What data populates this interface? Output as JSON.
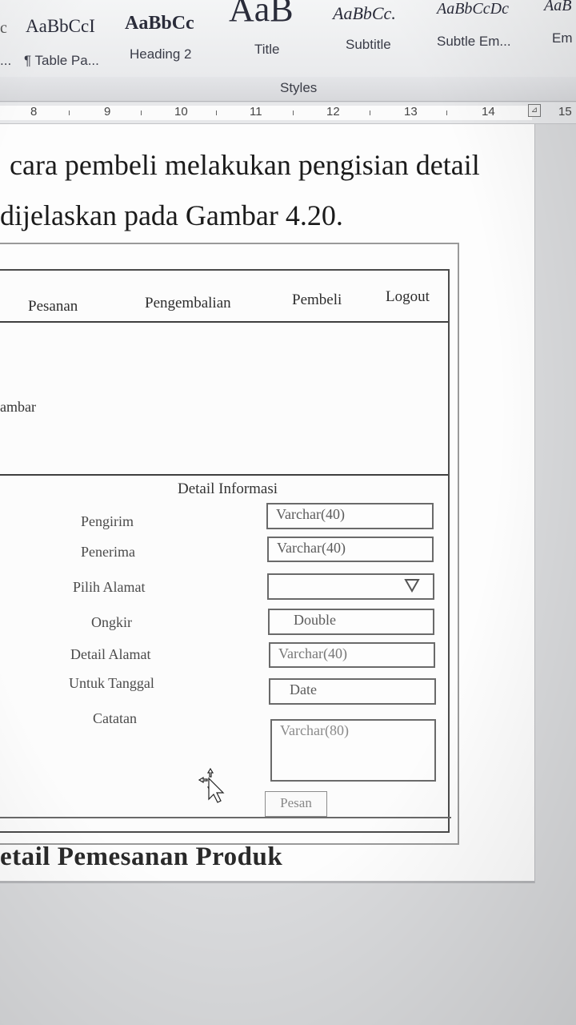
{
  "ribbon": {
    "styles": [
      {
        "sample": "AaBbCcI",
        "name": "¶ Table Pa..."
      },
      {
        "sample": "AaBbCc",
        "name": "Heading 2"
      },
      {
        "sample": "AaB",
        "name": "Title"
      },
      {
        "sample": "AaBbCc.",
        "name": "Subtitle"
      },
      {
        "sample": "AaBbCcDc",
        "name": "Subtle Em..."
      },
      {
        "sample": "AaB",
        "name": "Em"
      }
    ],
    "group_label": "Styles"
  },
  "ruler": {
    "numbers": [
      "8",
      "9",
      "10",
      "11",
      "12",
      "13",
      "14",
      "15"
    ]
  },
  "document": {
    "line1": "cara pembeli melakukan pengisian detail",
    "line2": "dijelaskan pada Gambar 4.20.",
    "caption": "etail Pemesanan Produk"
  },
  "mockup": {
    "nav": [
      "Pesanan",
      "Pengembalian",
      "Pembeli",
      "Logout"
    ],
    "image_label": "ambar",
    "section_title": "Detail Informasi",
    "fields": [
      {
        "label": "Pengirim",
        "value": "Varchar(40)"
      },
      {
        "label": "Penerima",
        "value": "Varchar(40)"
      },
      {
        "label": "Pilih Alamat",
        "value": ""
      },
      {
        "label": "Ongkir",
        "value": "Double"
      },
      {
        "label": "Detail Alamat",
        "value": "Varchar(40)"
      },
      {
        "label": "Untuk Tanggal",
        "value": "Date"
      },
      {
        "label": "Catatan",
        "value": "Varchar(80)"
      }
    ],
    "submit_label": "Pesan",
    "dropdown_icon": "triangle-down-icon",
    "cursor_icon": "move-cursor-icon"
  }
}
